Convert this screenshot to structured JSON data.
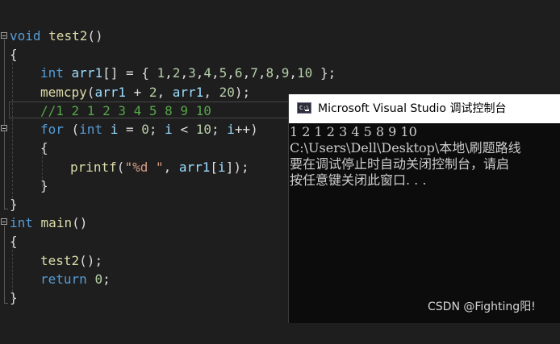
{
  "editor": {
    "lines": {
      "l1": {
        "kw": "void",
        "fn": "test2",
        "rest": "()"
      },
      "l2": {
        "text": "{"
      },
      "l3": {
        "kw": "int",
        "var": "arr1",
        "p1": "[] = { ",
        "n1": "1",
        "c1": ",",
        "n2": "2",
        "c2": ",",
        "n3": "3",
        "c3": ",",
        "n4": "4",
        "c4": ",",
        "n5": "5",
        "c5": ",",
        "n6": "6",
        "c6": ",",
        "n7": "7",
        "c7": ",",
        "n8": "8",
        "c8": ",",
        "n9": "9",
        "c9": ",",
        "n10": "10",
        "end": " };"
      },
      "l4": {
        "fn": "memcpy",
        "p1": "(",
        "v1": "arr1",
        "p2": " + ",
        "n1": "2",
        "p3": ", ",
        "v2": "arr1",
        "p4": ", ",
        "n2": "20",
        "p5": ");"
      },
      "l5": {
        "comment": "//1 2 1 2 3 4 5 8 9 10"
      },
      "l6": {
        "kw1": "for",
        "p1": " (",
        "kw2": "int",
        "p2": " ",
        "v1": "i",
        "p3": " = ",
        "n1": "0",
        "p4": "; ",
        "v2": "i",
        "p5": " < ",
        "n2": "10",
        "p6": "; ",
        "v3": "i",
        "p7": "++)"
      },
      "l7": {
        "text": "{"
      },
      "l8": {
        "fn": "printf",
        "p1": "(",
        "s1": "\"%d \"",
        "p2": ", ",
        "v1": "arr1",
        "p3": "[",
        "v2": "i",
        "p4": "]);"
      },
      "l9": {
        "text": "}"
      },
      "l10": {
        "text": "}"
      },
      "l11": {
        "kw": "int",
        "fn": "main",
        "rest": "()"
      },
      "l12": {
        "text": "{"
      },
      "l13": {
        "fn": "test2",
        "rest": "();"
      },
      "l14": {
        "kw": "return",
        "p1": " ",
        "n1": "0",
        "p2": ";"
      },
      "l15": {
        "text": "}"
      }
    }
  },
  "console": {
    "title": "Microsoft Visual Studio 调试控制台",
    "icon": "C:\\",
    "output": [
      "1 2 1 2 3 4 5 8 9 10",
      "C:\\Users\\Dell\\Desktop\\本地\\刷题路线",
      "要在调试停止时自动关闭控制台，请启",
      "按任意键关闭此窗口. . ."
    ]
  },
  "watermark": "CSDN @Fighting阳!",
  "colors": {
    "background": "#1e1e1e",
    "keyword": "#569cd6",
    "function": "#dcdcaa",
    "variable": "#9cdcfe",
    "number": "#b5cea8",
    "string": "#d69d85",
    "comment": "#57a64a",
    "console_bg": "#0c0c0c"
  }
}
